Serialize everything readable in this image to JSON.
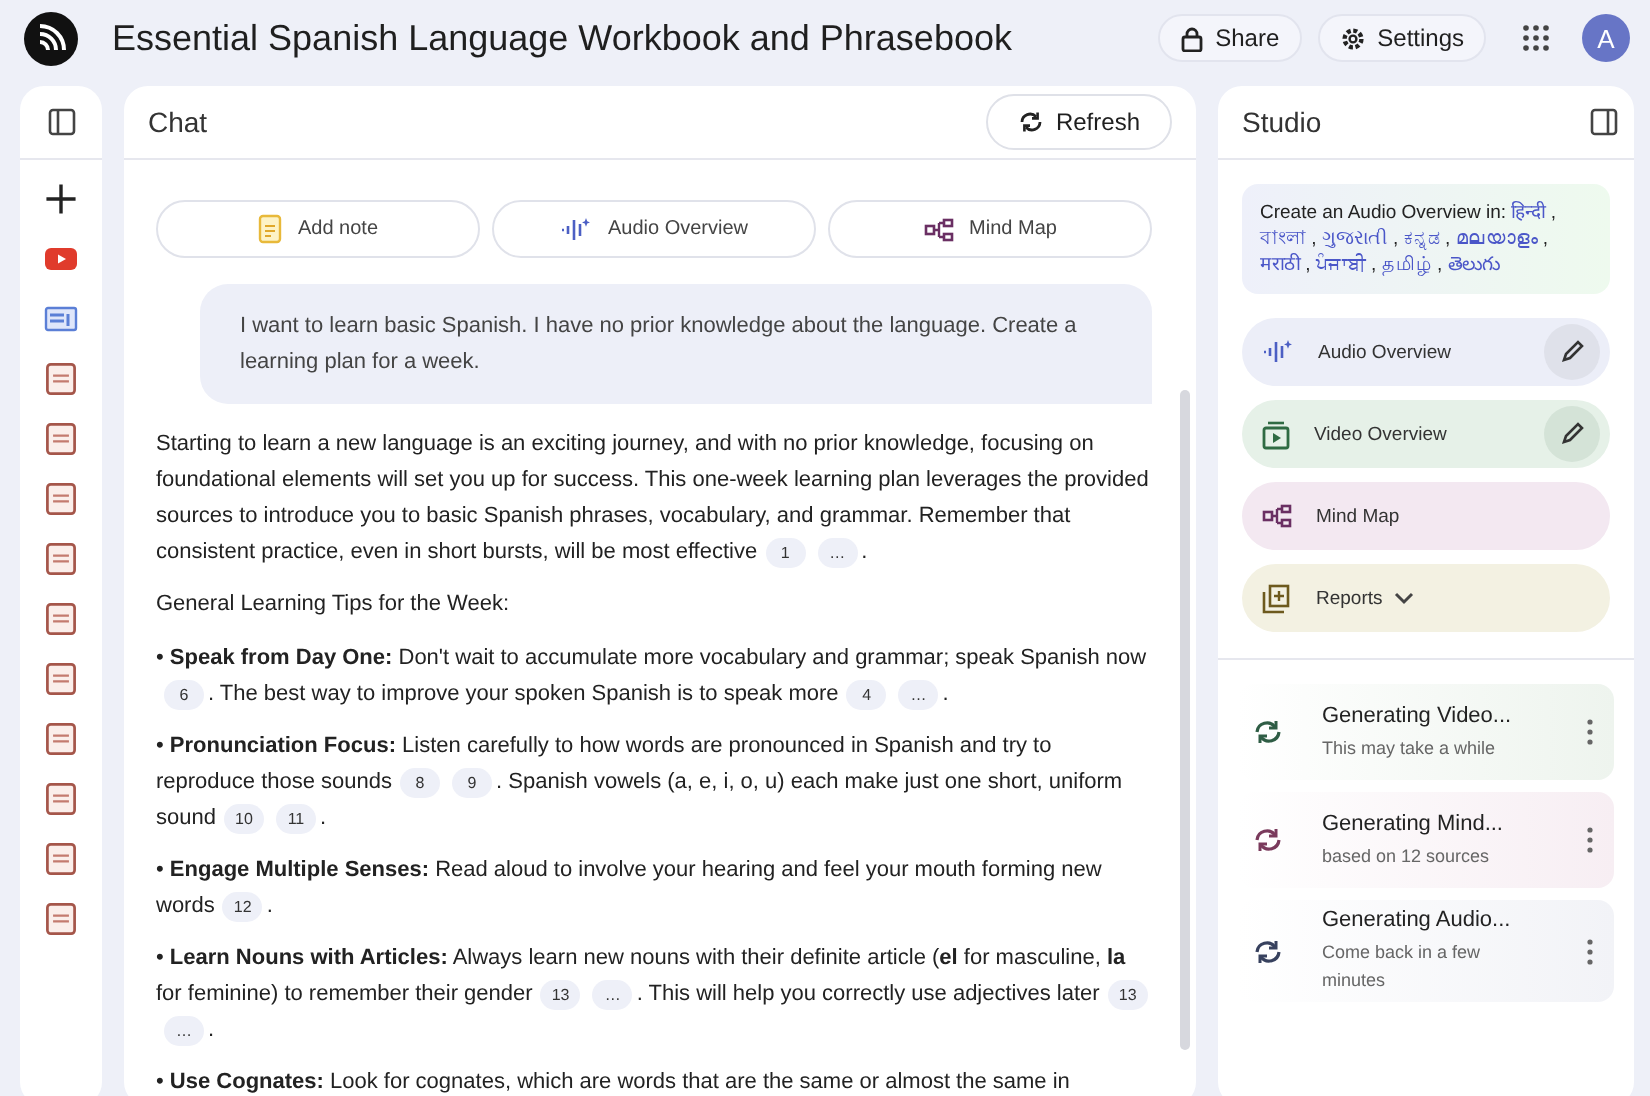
{
  "header": {
    "title": "Essential Spanish Language Workbook and Phrasebook",
    "actions": [
      {
        "kind": "share",
        "label": "Share"
      },
      {
        "kind": "settings",
        "label": "Settings"
      }
    ],
    "avatar": "A"
  },
  "sources": {
    "items": [
      {
        "kind": "add"
      },
      {
        "kind": "youtube"
      },
      {
        "kind": "web"
      },
      {
        "kind": "pdf"
      },
      {
        "kind": "pdf"
      },
      {
        "kind": "pdf"
      },
      {
        "kind": "pdf"
      },
      {
        "kind": "pdf"
      },
      {
        "kind": "pdf"
      },
      {
        "kind": "pdf"
      },
      {
        "kind": "pdf"
      },
      {
        "kind": "pdf"
      },
      {
        "kind": "pdf"
      }
    ]
  },
  "chat": {
    "title": "Chat",
    "refresh": "Refresh",
    "actions": [
      {
        "kind": "note",
        "label": "Add note"
      },
      {
        "kind": "audio",
        "label": "Audio Overview"
      },
      {
        "kind": "mindmap",
        "label": "Mind Map"
      }
    ],
    "user_message": "I want to learn basic Spanish. I have no prior knowledge about the language. Create a learning plan for a week.",
    "response": [
      {
        "kind": "paragraph",
        "parts": [
          {
            "text": "Starting to learn a new language is an exciting journey, and with no prior knowledge, focusing on foundational elements will set you up for success. This one-week learning plan leverages the provided sources to introduce you to basic Spanish phrases, vocabulary, and grammar. Remember that consistent practice, even in short bursts, will be most effective"
          },
          {
            "cite": "1"
          },
          {
            "cite": "…"
          },
          {
            "text": "."
          }
        ]
      },
      {
        "kind": "heading",
        "parts": [
          {
            "text": "General Learning Tips for the Week:"
          }
        ]
      },
      {
        "kind": "paragraph",
        "parts": [
          {
            "text": "• **Speak from Day One:** Don't wait to accumulate more vocabulary and grammar; speak Spanish now"
          },
          {
            "cite": "6"
          },
          {
            "text": ". The best way to improve your spoken Spanish is to speak more"
          },
          {
            "cite": "4"
          },
          {
            "cite": "…"
          },
          {
            "text": "."
          }
        ]
      },
      {
        "kind": "paragraph",
        "parts": [
          {
            "text": "• **Pronunciation Focus:** Listen carefully to how words are pronounced in Spanish and try to reproduce those sounds"
          },
          {
            "cite": "8"
          },
          {
            "cite": "9"
          },
          {
            "text": ". Spanish vowels (a, e, i, o, u) each make just one short, uniform sound"
          },
          {
            "cite": "10"
          },
          {
            "cite": "11"
          },
          {
            "text": "."
          }
        ]
      },
      {
        "kind": "paragraph",
        "parts": [
          {
            "text": "• **Engage Multiple Senses:** Read aloud to involve your hearing and feel your mouth forming new words"
          },
          {
            "cite": "12"
          },
          {
            "text": "."
          }
        ]
      },
      {
        "kind": "paragraph",
        "parts": [
          {
            "text": "• **Learn Nouns with Articles:** Always learn new nouns with their definite article (**el** for masculine, **la** for feminine) to remember their gender"
          },
          {
            "cite": "13"
          },
          {
            "cite": "…"
          },
          {
            "text": ". This will help you correctly use adjectives later"
          },
          {
            "cite": "13"
          },
          {
            "cite": "…"
          },
          {
            "text": "."
          }
        ]
      },
      {
        "kind": "paragraph",
        "parts": [
          {
            "text": "• **Use Cognates:** Look for cognates, which are words that are the same or almost the same in"
          }
        ]
      }
    ]
  },
  "studio": {
    "title": "Studio",
    "language_banner": {
      "label": "Create an Audio Overview in:",
      "separator": ",",
      "languages": [
        "हिन्दी",
        "বাংলা",
        "ગુજરાતી",
        "ಕನ್ನಡ",
        "മലയാളം",
        "मराठी",
        "ਪੰਜਾਬੀ",
        "தமிழ்",
        "తెలుగు"
      ]
    },
    "tools": [
      {
        "kind": "audio",
        "label": "Audio Overview",
        "editable": true
      },
      {
        "kind": "video",
        "label": "Video Overview",
        "editable": true
      },
      {
        "kind": "mindmap",
        "label": "Mind Map",
        "editable": false
      },
      {
        "kind": "reports",
        "label": "Reports",
        "editable": false
      }
    ],
    "jobs": [
      {
        "title": "Generating Video...",
        "subtitle": "This may take a while",
        "color": "#2f5d45"
      },
      {
        "title": "Generating Mind...",
        "subtitle": "based on 12 sources",
        "color": "#7a3a5c"
      },
      {
        "title": "Generating Audio...",
        "subtitle": "Come back in a few minutes",
        "color": "#37415e"
      }
    ]
  }
}
